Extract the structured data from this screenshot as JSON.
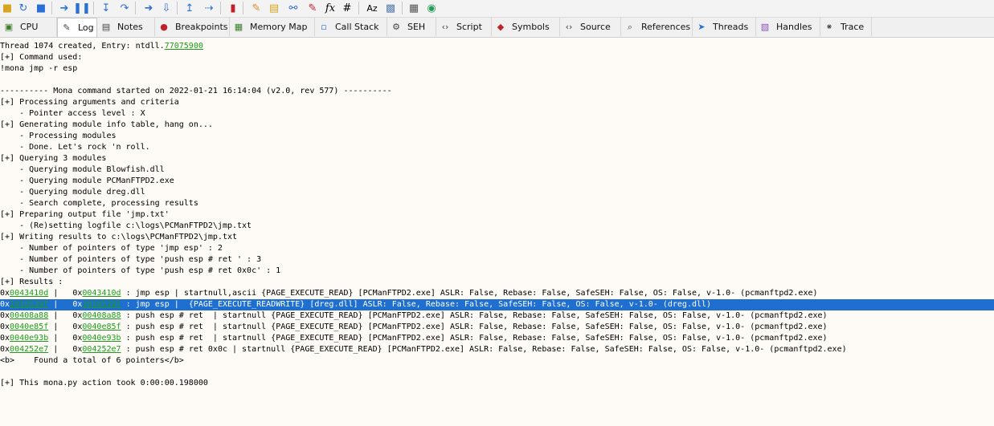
{
  "toolbar": {
    "icons": [
      "open-icon",
      "restart-icon",
      "close-icon",
      "run-icon",
      "pause-icon",
      "step-into-icon",
      "step-over-icon",
      "step-over-line-icon",
      "animate-icon",
      "execute-till-return-icon",
      "run-to-user-code-icon",
      "stop-icon",
      "patch-icon",
      "comments-icon",
      "labels-icon",
      "bookmarks-icon",
      "functions-icon",
      "variables-icon",
      "strings-icon",
      "calculator-icon",
      "web-icon"
    ],
    "fx_label": "fx",
    "hash_label": "#",
    "az_label": "Az"
  },
  "tabs": [
    {
      "label": "CPU",
      "icon": "cpu-icon"
    },
    {
      "label": "Log",
      "icon": "log-icon"
    },
    {
      "label": "Notes",
      "icon": "notes-icon"
    },
    {
      "label": "Breakpoints",
      "icon": "breakpoint-dot-icon"
    },
    {
      "label": "Memory Map",
      "icon": "memory-map-icon"
    },
    {
      "label": "Call Stack",
      "icon": "call-stack-icon"
    },
    {
      "label": "SEH",
      "icon": "seh-icon"
    },
    {
      "label": "Script",
      "icon": "script-icon"
    },
    {
      "label": "Symbols",
      "icon": "symbols-icon"
    },
    {
      "label": "Source",
      "icon": "source-icon"
    },
    {
      "label": "References",
      "icon": "references-icon"
    },
    {
      "label": "Threads",
      "icon": "threads-icon"
    },
    {
      "label": "Handles",
      "icon": "handles-icon"
    },
    {
      "label": "Trace",
      "icon": "trace-icon"
    }
  ],
  "active_tab": "Log",
  "colors": {
    "link": "#1a9e1a",
    "selection": "#1e6fd0",
    "background": "#fefaf5"
  },
  "log": {
    "thread_prefix": "Thread 1074 created, Entry: ntdll.",
    "thread_addr": "77075900",
    "lines_top": [
      "[+] Command used:",
      "!mona jmp -r esp",
      "",
      "---------- Mona command started on 2022-01-21 16:14:04 (v2.0, rev 577) ----------",
      "[+] Processing arguments and criteria",
      "    - Pointer access level : X",
      "[+] Generating module info table, hang on...",
      "    - Processing modules",
      "    - Done. Let's rock 'n roll.",
      "[+] Querying 3 modules",
      "    - Querying module Blowfish.dll",
      "    - Querying module PCManFTPD2.exe",
      "    - Querying module dreg.dll",
      "    - Search complete, processing results",
      "[+] Preparing output file 'jmp.txt'",
      "    - (Re)setting logfile c:\\logs\\PCManFTPD2\\jmp.txt",
      "[+] Writing results to c:\\logs\\PCManFTPD2\\jmp.txt",
      "    - Number of pointers of type 'jmp esp' : 2",
      "    - Number of pointers of type 'push esp # ret ' : 3",
      "    - Number of pointers of type 'push esp # ret 0x0c' : 1",
      "[+] Results :"
    ],
    "results": [
      {
        "addr": "0043410d",
        "rest": " : jmp esp | startnull,ascii {PAGE_EXECUTE_READ} [PCManFTPD2.exe] ASLR: False, Rebase: False, SafeSEH: False, OS: False, v-1.0- (pcmanftpd2.exe)",
        "selected": false
      },
      {
        "addr": "1010539f",
        "rest": " : jmp esp |  {PAGE_EXECUTE_READWRITE} [dreg.dll] ASLR: False, Rebase: False, SafeSEH: False, OS: False, v-1.0- (dreg.dll)",
        "selected": true
      },
      {
        "addr": "00408a88",
        "rest": " : push esp # ret  | startnull {PAGE_EXECUTE_READ} [PCManFTPD2.exe] ASLR: False, Rebase: False, SafeSEH: False, OS: False, v-1.0- (pcmanftpd2.exe)",
        "selected": false
      },
      {
        "addr": "0040e85f",
        "rest": " : push esp # ret  | startnull {PAGE_EXECUTE_READ} [PCManFTPD2.exe] ASLR: False, Rebase: False, SafeSEH: False, OS: False, v-1.0- (pcmanftpd2.exe)",
        "selected": false
      },
      {
        "addr": "0040e93b",
        "rest": " : push esp # ret  | startnull {PAGE_EXECUTE_READ} [PCManFTPD2.exe] ASLR: False, Rebase: False, SafeSEH: False, OS: False, v-1.0- (pcmanftpd2.exe)",
        "selected": false
      },
      {
        "addr": "004252e7",
        "rest": " : push esp # ret 0x0c | startnull {PAGE_EXECUTE_READ} [PCManFTPD2.exe] ASLR: False, Rebase: False, SafeSEH: False, OS: False, v-1.0- (pcmanftpd2.exe)",
        "selected": false
      }
    ],
    "lines_bottom": [
      "<b>    Found a total of 6 pointers</b>",
      "",
      "[+] This mona.py action took 0:00:00.198000"
    ]
  }
}
